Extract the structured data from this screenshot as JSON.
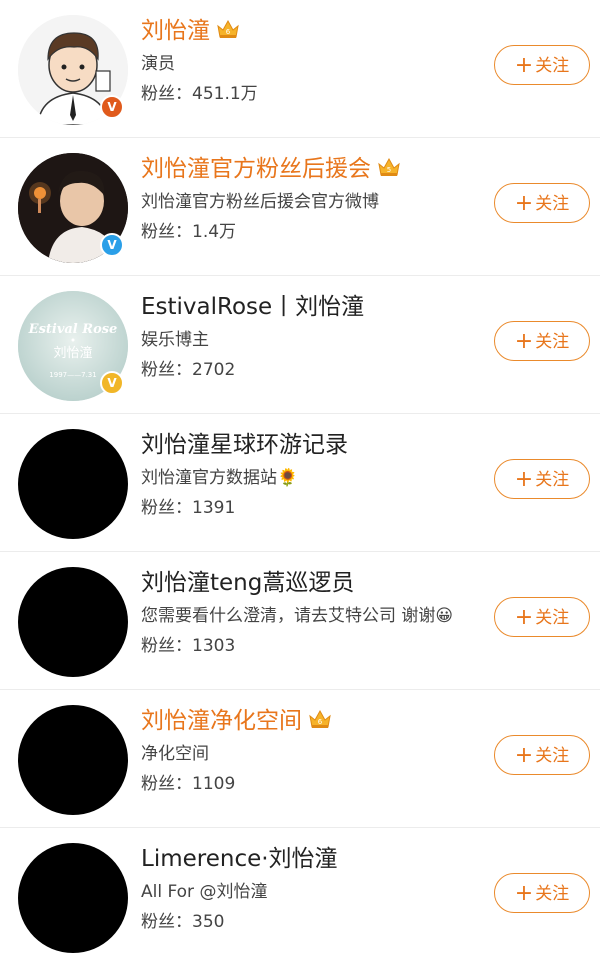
{
  "follow_label": "关注",
  "plus_glyph": "+",
  "rows": [
    {
      "name": "刘怡潼",
      "vip": true,
      "desc": "演员",
      "fans": "粉丝：451.1万",
      "badge": "V",
      "badge_color": "#e05a1c"
    },
    {
      "name": "刘怡潼官方粉丝后援会",
      "vip": true,
      "desc": "刘怡潼官方粉丝后援会官方微博",
      "fans": "粉丝：1.4万",
      "badge": "V",
      "badge_color": "#2a9fe8"
    },
    {
      "name": "EstivalRose丨刘怡潼",
      "vip": false,
      "desc": "娱乐博主",
      "fans": "粉丝：2702",
      "badge": "V",
      "badge_color": "#f1b628",
      "avatar_text": "Estival Rose",
      "avatar_sub": "刘怡潼",
      "avatar_date": "1997——7.31"
    },
    {
      "name": "刘怡潼星球环游记录",
      "vip": false,
      "desc": "刘怡潼官方数据站",
      "desc_emoji": "🌻",
      "fans": "粉丝：1391"
    },
    {
      "name": "刘怡潼teng蒿巡逻员",
      "vip": false,
      "desc": "您需要看什么澄清，请去艾特公司 谢谢",
      "desc_emoji": "😀",
      "fans": "粉丝：1303"
    },
    {
      "name": "刘怡潼净化空间",
      "vip": true,
      "desc": "净化空间",
      "fans": "粉丝：1109"
    },
    {
      "name": "Limerence·刘怡潼",
      "vip": false,
      "desc": "All For @刘怡潼",
      "fans": "粉丝：350"
    }
  ]
}
